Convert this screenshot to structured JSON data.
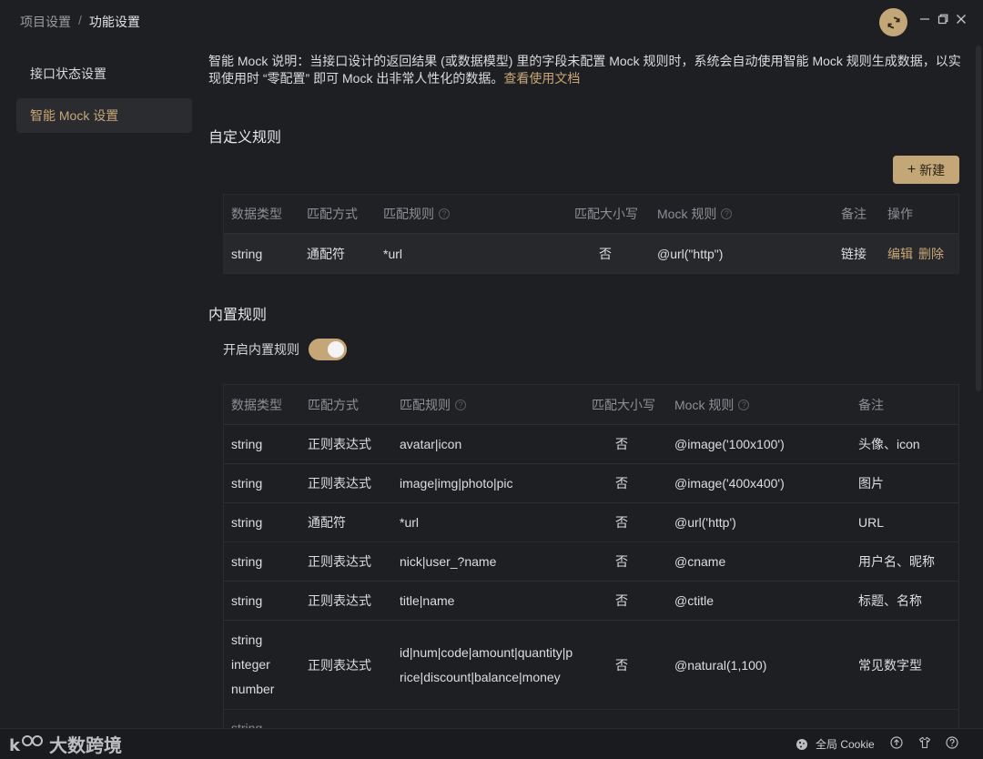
{
  "breadcrumb": {
    "parent": "项目设置",
    "separator": "/",
    "current": "功能设置"
  },
  "sidebar": {
    "items": [
      {
        "label": "接口状态设置"
      },
      {
        "label": "智能 Mock 设置"
      }
    ]
  },
  "description": {
    "text": "智能 Mock 说明：当接口设计的返回结果 (或数据模型) 里的字段未配置 Mock 规则时，系统会自动使用智能 Mock 规则生成数据，以实现使用时 “零配置” 即可 Mock 出非常人性化的数据。",
    "link": "查看使用文档"
  },
  "custom": {
    "title": "自定义规则",
    "new_button": "新建",
    "headers": [
      "数据类型",
      "匹配方式",
      "匹配规则",
      "匹配大小写",
      "Mock 规则",
      "备注",
      "操作"
    ],
    "rows": [
      {
        "type": "string",
        "method": "通配符",
        "rule": "*url",
        "case": "否",
        "mock": "@url(\"http\")",
        "note": "链接",
        "edit": "编辑",
        "delete": "删除"
      }
    ]
  },
  "builtin": {
    "title": "内置规则",
    "toggle_label": "开启内置规则",
    "toggle_on": true,
    "headers": [
      "数据类型",
      "匹配方式",
      "匹配规则",
      "匹配大小写",
      "Mock 规则",
      "备注"
    ],
    "rows": [
      {
        "type": [
          "string"
        ],
        "method": "正则表达式",
        "rule": [
          "avatar|icon"
        ],
        "case": "否",
        "mock": "@image('100x100')",
        "note": "头像、icon"
      },
      {
        "type": [
          "string"
        ],
        "method": "正则表达式",
        "rule": [
          "image|img|photo|pic"
        ],
        "case": "否",
        "mock": "@image('400x400')",
        "note": "图片"
      },
      {
        "type": [
          "string"
        ],
        "method": "通配符",
        "rule": [
          "*url"
        ],
        "case": "否",
        "mock": "@url('http')",
        "note": "URL"
      },
      {
        "type": [
          "string"
        ],
        "method": "正则表达式",
        "rule": [
          "nick|user_?name"
        ],
        "case": "否",
        "mock": "@cname",
        "note": "用户名、昵称"
      },
      {
        "type": [
          "string"
        ],
        "method": "正则表达式",
        "rule": [
          "title|name"
        ],
        "case": "否",
        "mock": "@ctitle",
        "note": "标题、名称"
      },
      {
        "type": [
          "string",
          "integer",
          "number"
        ],
        "method": "正则表达式",
        "rule": [
          "id|num|code|amount|quantity|p",
          "rice|discount|balance|money"
        ],
        "case": "否",
        "mock": "@natural(1,100)",
        "note": "常见数字型"
      },
      {
        "type": [
          "string"
        ],
        "method": "",
        "rule": [
          ""
        ],
        "case": "",
        "mock": "",
        "note": ""
      }
    ]
  },
  "statusbar": {
    "watermark": "大数跨境",
    "cookie_label": "全局 Cookie"
  },
  "colors": {
    "accent": "#c4a776",
    "background": "#1e1f22",
    "link": "#c8a775"
  }
}
